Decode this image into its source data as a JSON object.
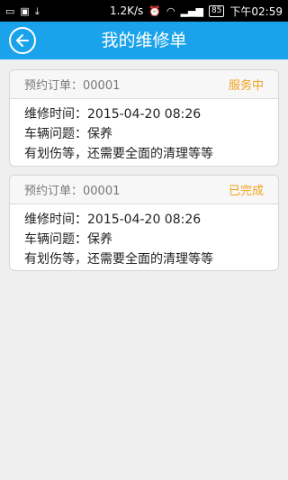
{
  "status_bar": {
    "net_speed": "1.2K/s",
    "battery": "85",
    "time": "下午02:59"
  },
  "header": {
    "title": "我的维修单"
  },
  "orders": [
    {
      "order_label": "预约订单：00001",
      "status": "服务中",
      "repair_time": "维修时间：2015-04-20 08:26",
      "problem": "车辆问题：保养",
      "note": "有划伤等，还需要全面的清理等等"
    },
    {
      "order_label": "预约订单：00001",
      "status": "已完成",
      "repair_time": "维修时间：2015-04-20 08:26",
      "problem": "车辆问题：保养",
      "note": "有划伤等，还需要全面的清理等等"
    }
  ],
  "colors": {
    "app_bar": "#1aa3ea",
    "status_accent": "#f0a21d"
  },
  "icons": [
    "back-arrow-icon",
    "download-icon",
    "image-icon",
    "alarm-icon",
    "wifi-icon",
    "signal-icon"
  ]
}
